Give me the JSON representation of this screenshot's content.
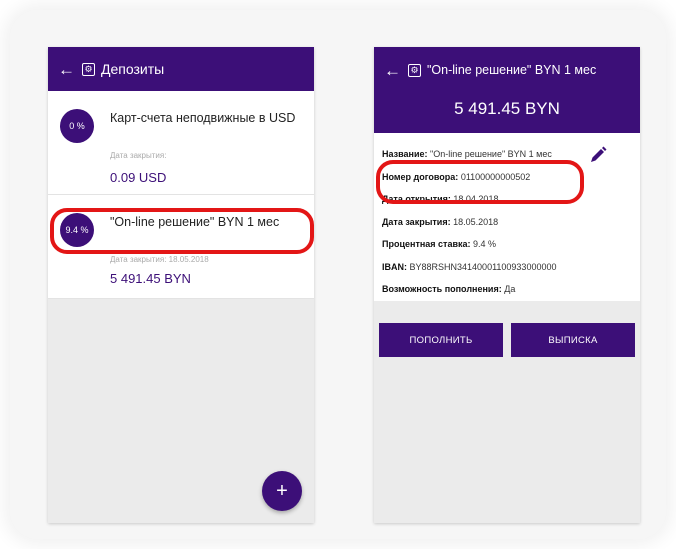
{
  "left_screen": {
    "title": "Депозиты",
    "deposits": [
      {
        "rate": "0 %",
        "name": "Карт-счета неподвижные в USD",
        "date_label": "Дата закрытия:",
        "amount": "0.09 USD"
      },
      {
        "rate": "9.4 %",
        "name": "\"On-line решение\" BYN 1 мес",
        "date_label": "Дата закрытия: 18.05.2018",
        "amount": "5 491.45 BYN"
      }
    ],
    "fab_symbol": "+"
  },
  "right_screen": {
    "title": "\"On-line решение\" BYN 1 мес",
    "amount": "5 491.45 BYN",
    "fields": [
      {
        "label": "Название:",
        "value": "\"On-line решение\" BYN 1 мес"
      },
      {
        "label": "Номер договора:",
        "value": "01100000000502"
      },
      {
        "label": "Дата открытия:",
        "value": "18.04.2018"
      },
      {
        "label": "Дата закрытия:",
        "value": "18.05.2018"
      },
      {
        "label": "Процентная ставка:",
        "value": "9.4 %"
      },
      {
        "label": "IBAN:",
        "value": "BY88RSHN34140001100933000000"
      },
      {
        "label": "Возможность пополнения:",
        "value": "Да"
      }
    ],
    "buttons": {
      "replenish": "ПОПОЛНИТЬ",
      "statement": "ВЫПИСКА"
    }
  },
  "icons": {
    "back": "arrow-left-icon",
    "settings": "gear-icon",
    "edit": "pencil-icon",
    "add": "plus-icon"
  },
  "colors": {
    "primary": "#3c0f78",
    "highlight": "#e31616",
    "background": "#ebebeb"
  }
}
